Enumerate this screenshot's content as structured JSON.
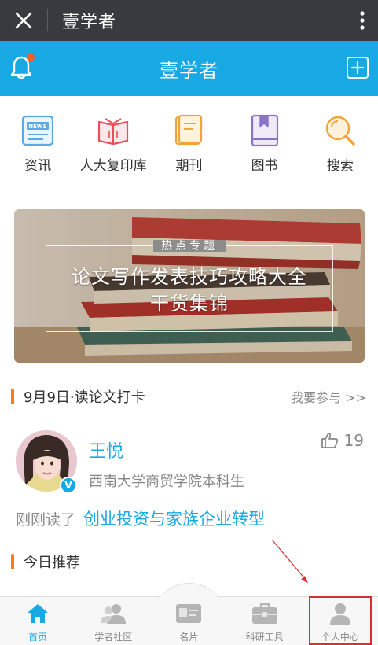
{
  "wechat_bar": {
    "title": "壹学者",
    "close_icon": "close-icon",
    "more_icon": "more-vertical-icon"
  },
  "app_header": {
    "title": "壹学者",
    "bell_icon": "bell-icon",
    "add_icon": "add-square-icon",
    "notification_dot": true
  },
  "categories": [
    {
      "label": "资讯",
      "icon": "news-icon"
    },
    {
      "label": "人大复印库",
      "icon": "book-open-icon"
    },
    {
      "label": "期刊",
      "icon": "journal-icon"
    },
    {
      "label": "图书",
      "icon": "bookmark-book-icon"
    },
    {
      "label": "搜索",
      "icon": "search-icon"
    }
  ],
  "banner": {
    "tag": "热点专题",
    "line1": "论文写作发表技巧攻略大全",
    "line2": "干货集锦"
  },
  "checkin": {
    "title": "9月9日·读论文打卡",
    "link": "我要参与 >>"
  },
  "card": {
    "name": "王悦",
    "school": "西南大学商贸学院本科生",
    "verified_badge": "V",
    "likes": "19",
    "read_prefix": "刚刚读了",
    "book_title": "创业投资与家族企业转型"
  },
  "recommend": {
    "title": "今日推荐"
  },
  "nav": [
    {
      "label": "首页",
      "icon": "home-icon",
      "active": true
    },
    {
      "label": "学者社区",
      "icon": "community-icon",
      "active": false
    },
    {
      "label": "名片",
      "icon": "card-icon",
      "active": false
    },
    {
      "label": "科研工具",
      "icon": "toolbox-icon",
      "active": false
    },
    {
      "label": "个人中心",
      "icon": "person-icon",
      "active": false
    }
  ],
  "colors": {
    "brand": "#18a8e3",
    "accent": "#ff7a1a",
    "wechat_bar": "#393a3f",
    "annotation": "#d83030"
  }
}
